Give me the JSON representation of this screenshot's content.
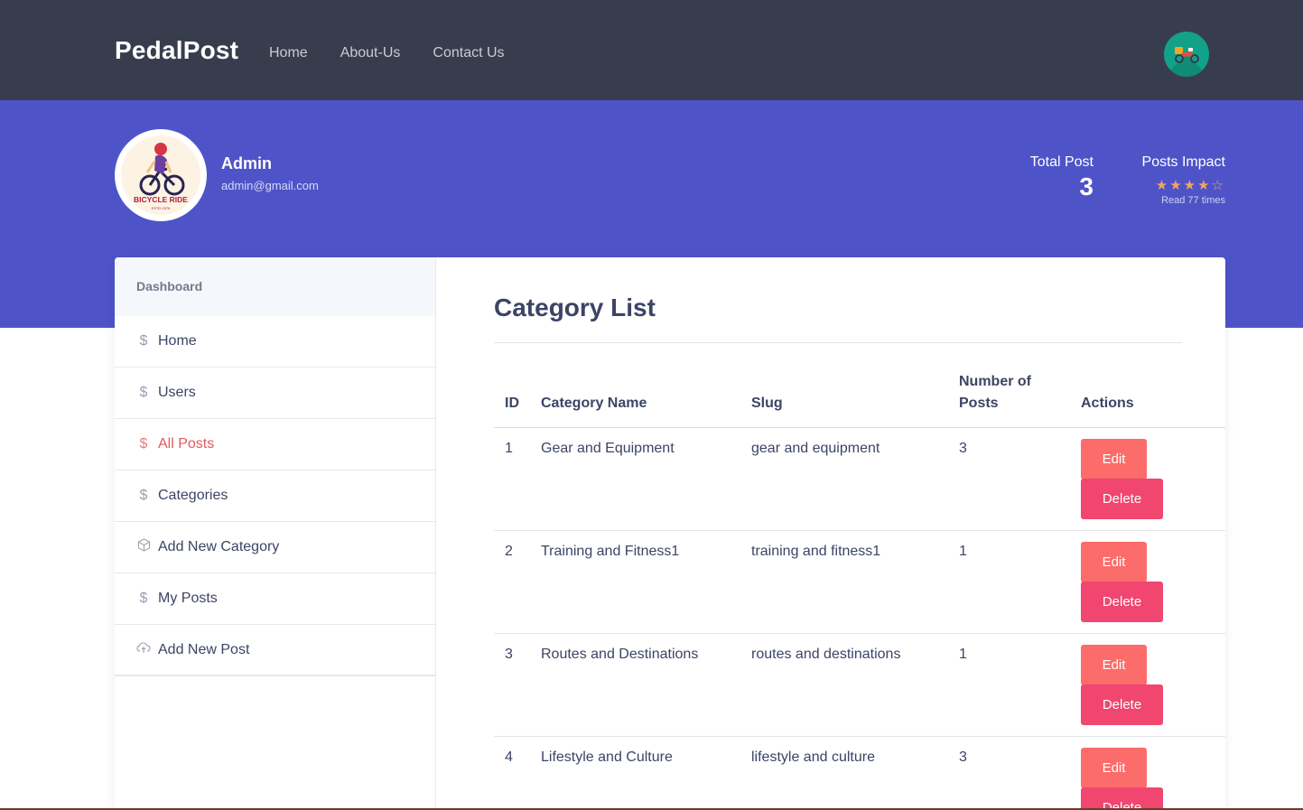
{
  "brand": "PedalPost",
  "nav": [
    "Home",
    "About-Us",
    "Contact Us"
  ],
  "profile": {
    "name": "Admin",
    "email": "admin@gmail.com",
    "logo_text": "BICYCLE RIDE",
    "logo_subtext": "ESTD 1976"
  },
  "stats": {
    "total_label": "Total Post",
    "total_value": "3",
    "impact_label": "Posts Impact",
    "rating": 4,
    "rating_max": 5,
    "reads": "Read 77 times"
  },
  "sidebar": {
    "header": "Dashboard",
    "items": [
      {
        "label": "Home",
        "icon": "dollar-icon"
      },
      {
        "label": "Users",
        "icon": "dollar-icon"
      },
      {
        "label": "All Posts",
        "icon": "dollar-icon",
        "active": true
      },
      {
        "label": "Categories",
        "icon": "dollar-icon"
      },
      {
        "label": "Add New Category",
        "icon": "box-icon"
      },
      {
        "label": "My Posts",
        "icon": "dollar-icon"
      },
      {
        "label": "Add New Post",
        "icon": "cloud-upload-icon"
      }
    ]
  },
  "main": {
    "title": "Category List",
    "columns": [
      "ID",
      "Category Name",
      "Slug",
      "Number of Posts",
      "Actions"
    ],
    "rows": [
      {
        "id": "1",
        "name": "Gear and Equipment",
        "slug": "gear and equipment",
        "posts": "3"
      },
      {
        "id": "2",
        "name": "Training and Fitness1",
        "slug": "training and fitness1",
        "posts": "1"
      },
      {
        "id": "3",
        "name": "Routes and Destinations",
        "slug": "routes and destinations",
        "posts": "1"
      },
      {
        "id": "4",
        "name": "Lifestyle and Culture",
        "slug": "lifestyle and culture",
        "posts": "3"
      }
    ],
    "edit_label": "Edit",
    "delete_label": "Delete"
  },
  "colors": {
    "topbar": "#383d4e",
    "hero": "#4e54c8",
    "edit": "#fb6c6a",
    "delete": "#f0466f",
    "active": "#e05a5a"
  }
}
